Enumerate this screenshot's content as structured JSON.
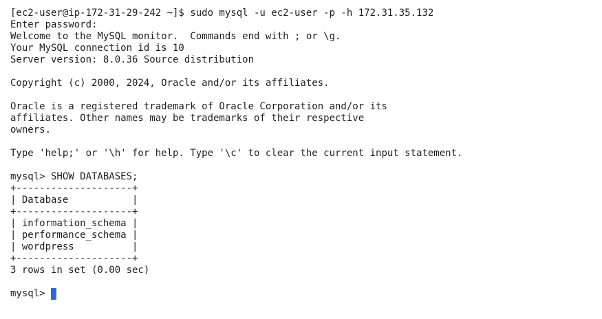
{
  "terminal": {
    "lines": [
      "[ec2-user@ip-172-31-29-242 ~]$ sudo mysql -u ec2-user -p -h 172.31.35.132",
      "Enter password:",
      "Welcome to the MySQL monitor.  Commands end with ; or \\g.",
      "Your MySQL connection id is 10",
      "Server version: 8.0.36 Source distribution",
      "",
      "Copyright (c) 2000, 2024, Oracle and/or its affiliates.",
      "",
      "Oracle is a registered trademark of Oracle Corporation and/or its",
      "affiliates. Other names may be trademarks of their respective",
      "owners.",
      "",
      "Type 'help;' or '\\h' for help. Type '\\c' to clear the current input statement.",
      "",
      "mysql> SHOW DATABASES;",
      "+--------------------+",
      "| Database           |",
      "+--------------------+",
      "| information_schema |",
      "| performance_schema |",
      "| wordpress          |",
      "+--------------------+",
      "3 rows in set (0.00 sec)",
      ""
    ],
    "prompt": "mysql> ",
    "cursor_color": "#2f6bd4"
  }
}
